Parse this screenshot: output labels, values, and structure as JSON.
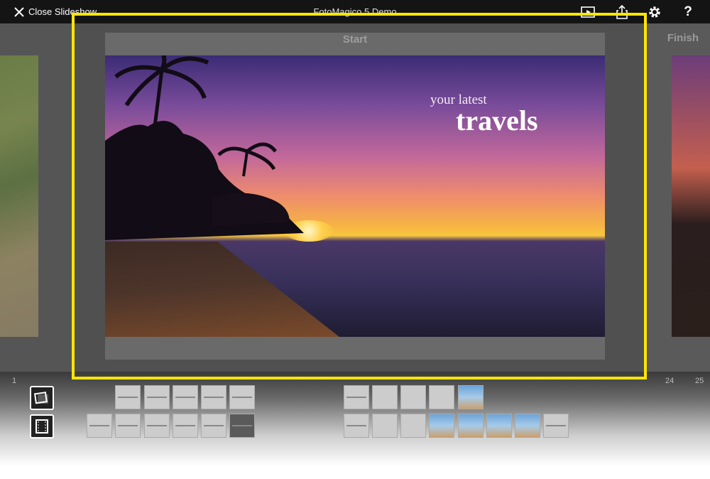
{
  "topbar": {
    "close_label": "Close Slideshow",
    "app_title": "FotoMagico 5 Demo"
  },
  "icons": {
    "close": "close-x-icon",
    "play": "play-preview-icon",
    "share": "share-icon",
    "settings": "gear-icon",
    "help": "help-icon"
  },
  "help_glyph": "?",
  "slides": {
    "start_label": "Start",
    "finish_label": "Finish"
  },
  "overlay": {
    "line1": "your latest",
    "line2": "travels"
  },
  "timeline": {
    "track_numbers": [
      "1",
      "24",
      "25"
    ]
  },
  "colors": {
    "highlight": "#ffe600",
    "topbar": "#141414"
  }
}
